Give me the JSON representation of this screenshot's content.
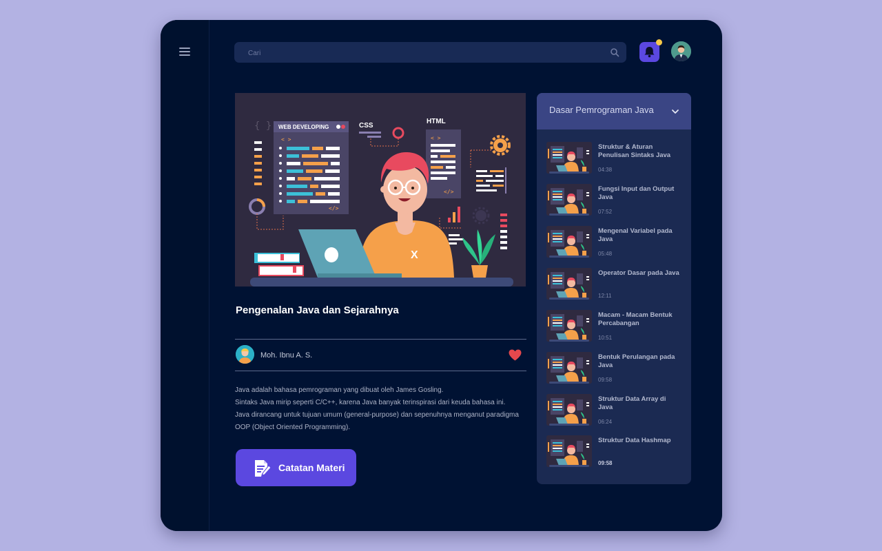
{
  "search": {
    "placeholder": "Cari"
  },
  "lesson": {
    "title": "Pengenalan Java dan Sejarahnya",
    "author": "Moh. Ibnu A. S.",
    "description": [
      "Java adalah bahasa pemrograman yang dibuat oleh James Gosling.",
      "Sintaks Java mirip seperti C/C++, karena Java banyak terinspirasi dari keuda bahasa ini.",
      "Java dirancang untuk tujuan umum (general-purpose) dan sepenuhnya menganut paradigma OOP (Object Oriented Programming)."
    ],
    "notes_button": "Catatan Materi",
    "hero_labels": {
      "web": "WEB DEVELOPING",
      "css": "CSS",
      "html": "HTML"
    }
  },
  "playlist": {
    "title": "Dasar Pemrograman Java",
    "items": [
      {
        "title": "Struktur & Aturan Penulisan Sintaks Java",
        "duration": "04:38"
      },
      {
        "title": "Fungsi Input dan Output Java",
        "duration": "07:52"
      },
      {
        "title": "Mengenal Variabel pada Java",
        "duration": "05:48"
      },
      {
        "title": "Operator Dasar pada Java",
        "duration": "12:11"
      },
      {
        "title": "Macam - Macam Bentuk Percabangan",
        "duration": "10:51"
      },
      {
        "title": "Bentuk Perulangan pada Java",
        "duration": "09:58"
      },
      {
        "title": "Struktur Data Array di Java",
        "duration": "06:24"
      },
      {
        "title": "Struktur Data Hashmap",
        "duration": "09:58"
      }
    ]
  },
  "colors": {
    "background": "#b3b2e3",
    "app": "#001233",
    "accent": "#5b48e0",
    "panel": "#1b2a52",
    "panel_header": "#3a4584",
    "heart": "#e5484d",
    "notification_dot": "#f7c948"
  },
  "icons": {
    "menu": "menu-icon",
    "search": "search-icon",
    "bell": "bell-icon",
    "heart": "heart-icon",
    "notes": "notes-edit-icon",
    "chevron": "chevron-down-icon"
  }
}
